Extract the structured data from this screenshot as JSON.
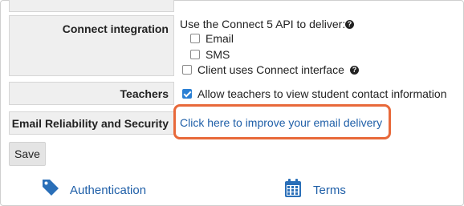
{
  "connect_integration": {
    "label": "Connect integration",
    "api_text": "Use the Connect 5 API to deliver:",
    "options": [
      {
        "label": "Email",
        "checked": false
      },
      {
        "label": "SMS",
        "checked": false
      }
    ],
    "client_interface": {
      "label": "Client uses Connect interface",
      "checked": false
    }
  },
  "teachers": {
    "label": "Teachers",
    "option": {
      "label": "Allow teachers to view student contact information",
      "checked": true
    }
  },
  "email_reliability": {
    "label": "Email Reliability and Security",
    "link_text": "Click here to improve your email delivery"
  },
  "save_label": "Save",
  "bottom_nav": [
    {
      "label": "Authentication",
      "icon": "tag-icon"
    },
    {
      "label": "Terms",
      "icon": "calendar-icon"
    }
  ],
  "colors": {
    "link": "#1f5fa8",
    "highlight": "#e8693a",
    "checkbox_checked": "#2a7fd4"
  }
}
